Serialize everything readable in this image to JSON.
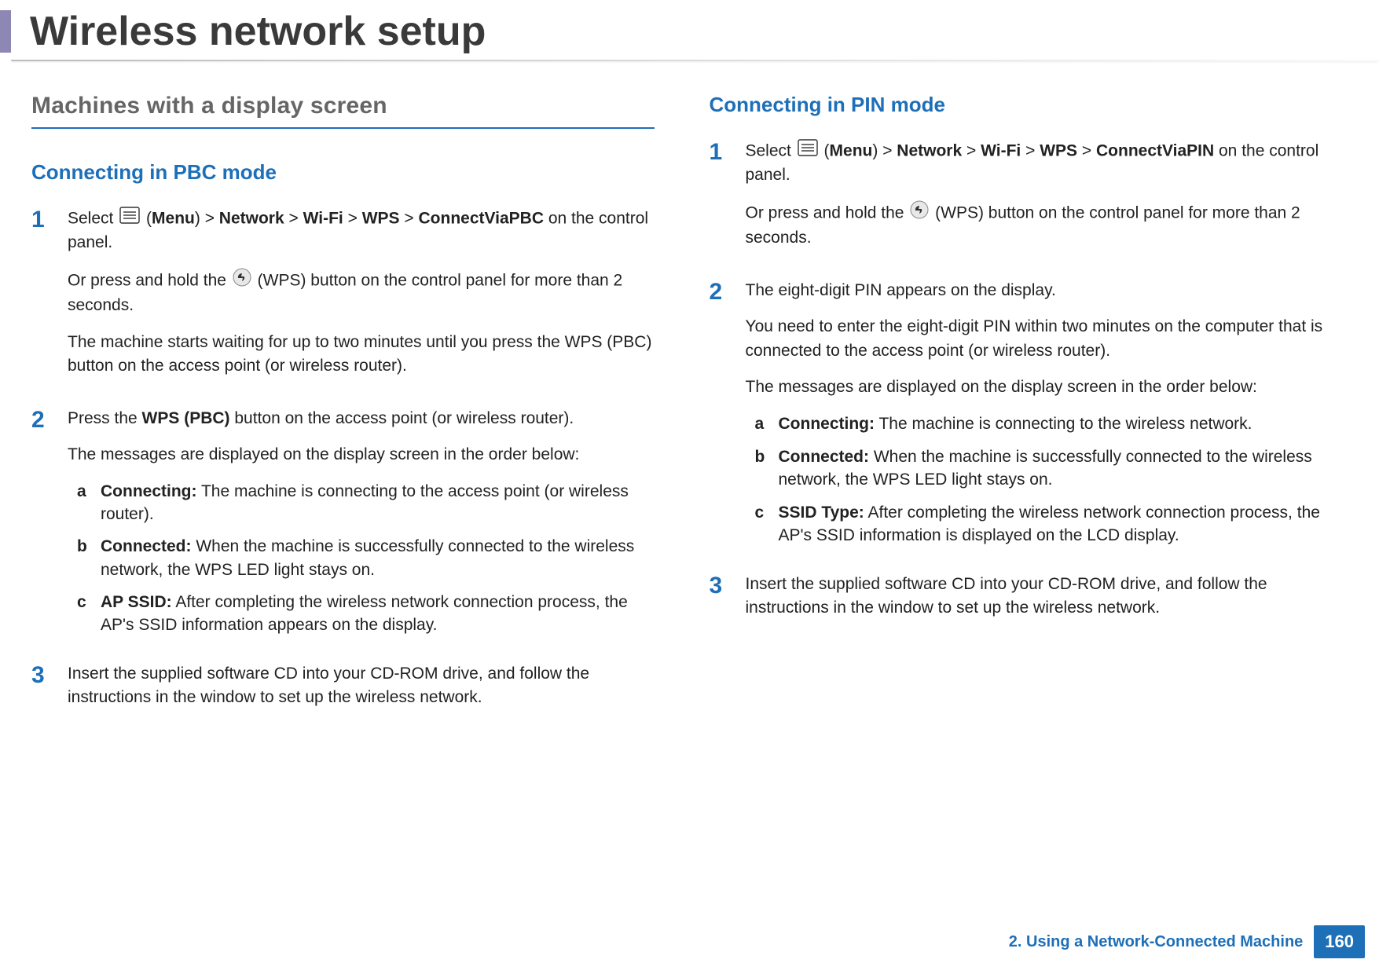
{
  "header": {
    "title": "Wireless network setup"
  },
  "left": {
    "section": "Machines with a display screen",
    "heading": "Connecting in PBC mode",
    "steps": [
      {
        "num": "1",
        "select_prefix": "Select ",
        "menu_label": "Menu",
        "path1": "Network",
        "path2": "Wi-Fi",
        "path3": "WPS",
        "path4": "ConnectViaPBC",
        "select_suffix": " on the control panel.",
        "para2_pre": "Or press and hold the ",
        "para2_post": " (WPS) button on the control panel for more than 2 seconds.",
        "para3": "The machine starts waiting for up to two minutes until you press the WPS (PBC) button on the access point (or wireless router)."
      },
      {
        "num": "2",
        "line_pre": "Press the ",
        "line_bold": "WPS (PBC)",
        "line_post": " button on the access point (or wireless router).",
        "para2": "The messages are displayed on the display screen in the order below:",
        "subs": [
          {
            "letter": "a",
            "label": "Connecting:",
            "text": " The machine is connecting to the access point (or wireless router)."
          },
          {
            "letter": "b",
            "label": "Connected:",
            "text": " When the machine is successfully connected to the wireless network, the WPS LED light stays on."
          },
          {
            "letter": "c",
            "label": "AP SSID:",
            "text": " After completing the wireless network connection process, the AP's SSID information appears on the display."
          }
        ]
      },
      {
        "num": "3",
        "text": "Insert the supplied software CD into your CD-ROM drive, and follow the instructions in the window to set up the wireless network."
      }
    ]
  },
  "right": {
    "heading": "Connecting in PIN mode",
    "steps": [
      {
        "num": "1",
        "select_prefix": "Select ",
        "menu_label": "Menu",
        "path1": "Network",
        "path2": "Wi-Fi",
        "path3": "WPS",
        "path4": "ConnectViaPIN",
        "select_suffix": " on the control panel.",
        "para2_pre": "Or press and hold the ",
        "para2_post": " (WPS) button on the control panel for more than 2 seconds."
      },
      {
        "num": "2",
        "line": "The eight-digit PIN appears on the display.",
        "para2": "You need to enter the eight-digit PIN within two minutes on the computer that is connected to the access point (or wireless router).",
        "para3": "The messages are displayed on the display screen in the order below:",
        "subs": [
          {
            "letter": "a",
            "label": "Connecting:",
            "text": " The machine is connecting to the wireless network."
          },
          {
            "letter": "b",
            "label": "Connected:",
            "text": " When the machine is successfully connected to the wireless network, the WPS LED light stays on."
          },
          {
            "letter": "c",
            "label": "SSID Type:",
            "text": " After completing the wireless network connection process, the AP's SSID information is displayed on the LCD display."
          }
        ]
      },
      {
        "num": "3",
        "text": "Insert the supplied software CD into your CD-ROM drive, and follow the instructions in the window to set up the wireless network."
      }
    ]
  },
  "footer": {
    "chapter": "2.  Using a Network-Connected Machine",
    "page": "160"
  },
  "glyphs": {
    "gt": ">"
  }
}
